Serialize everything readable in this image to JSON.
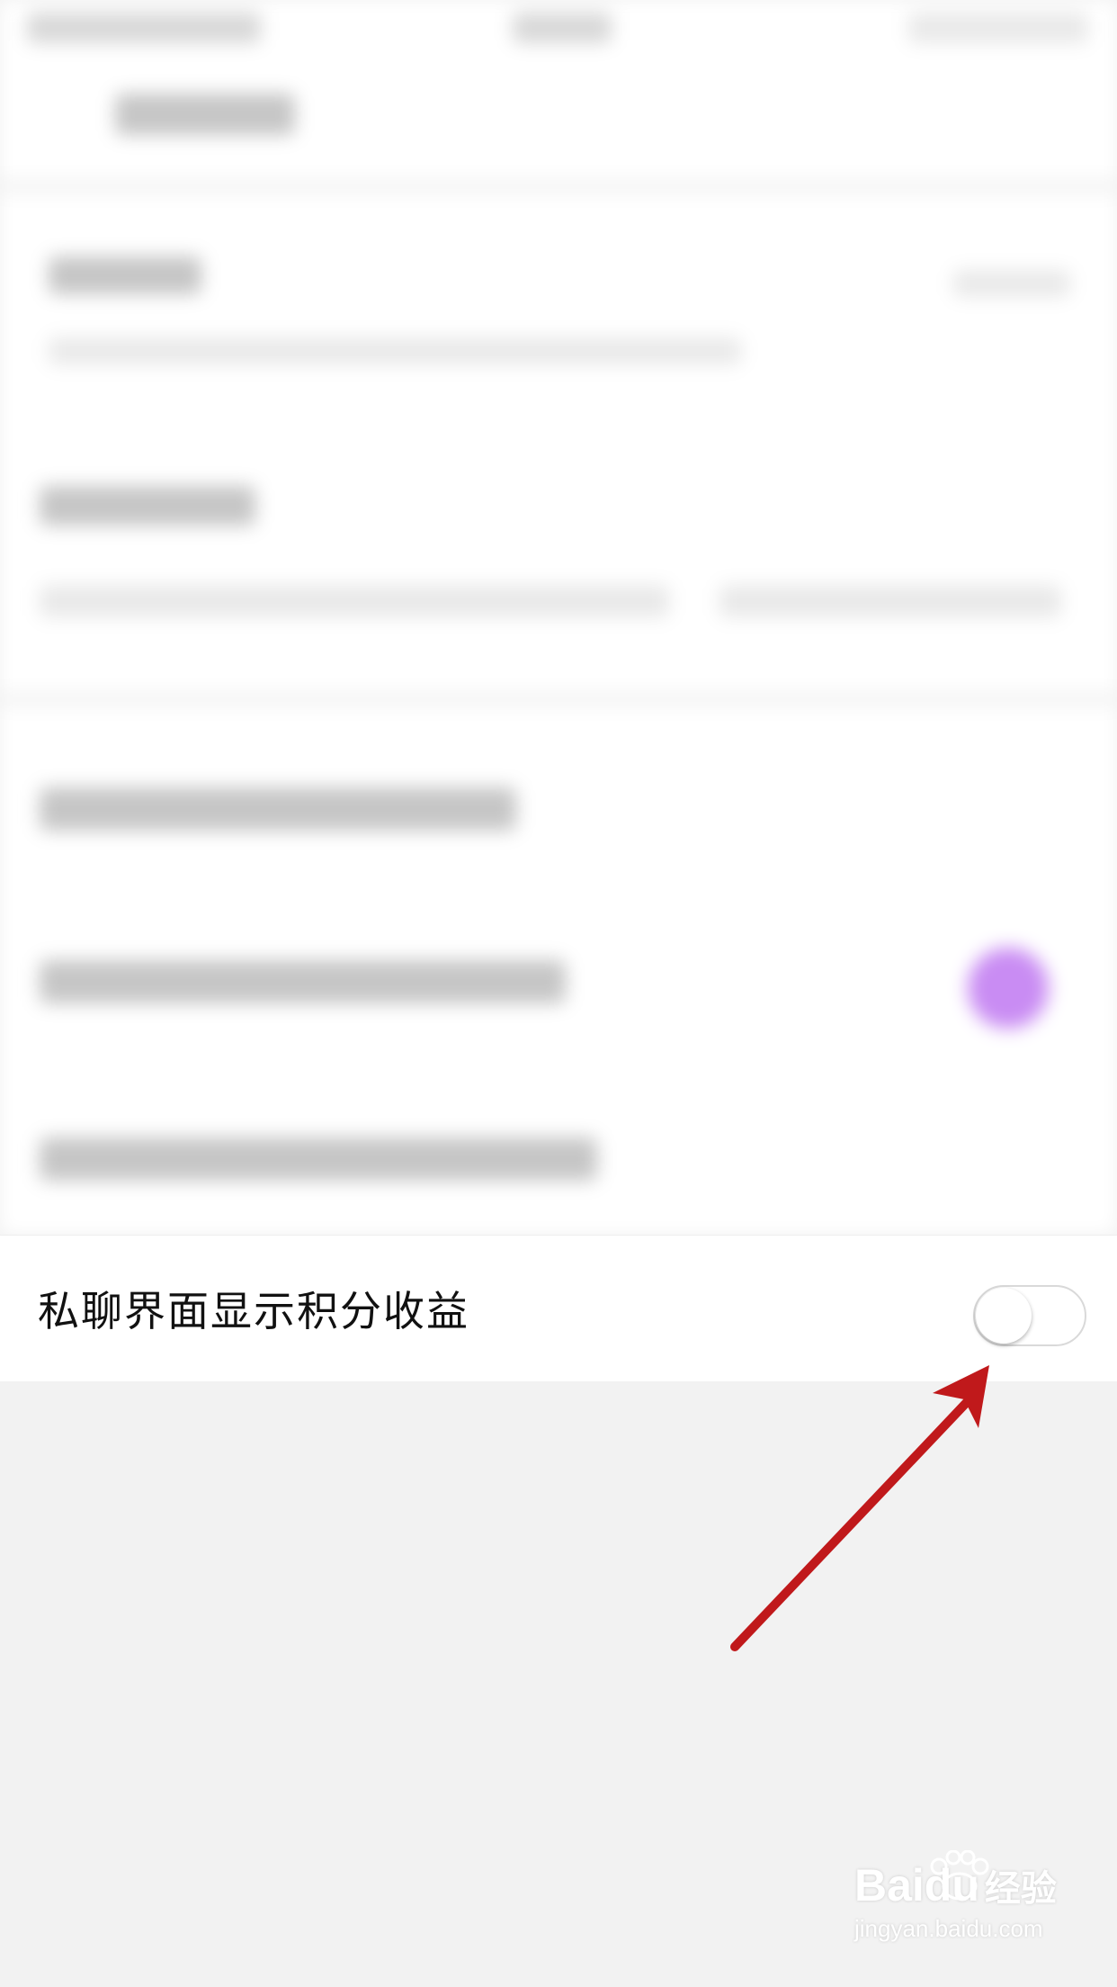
{
  "setting": {
    "label": "私聊界面显示积分收益",
    "toggle_state": "off"
  },
  "annotation": {
    "arrow_color": "#c0191b"
  },
  "watermark": {
    "logo": "Baidu",
    "logo_cn": "经验",
    "url": "jingyan.baidu.com"
  }
}
